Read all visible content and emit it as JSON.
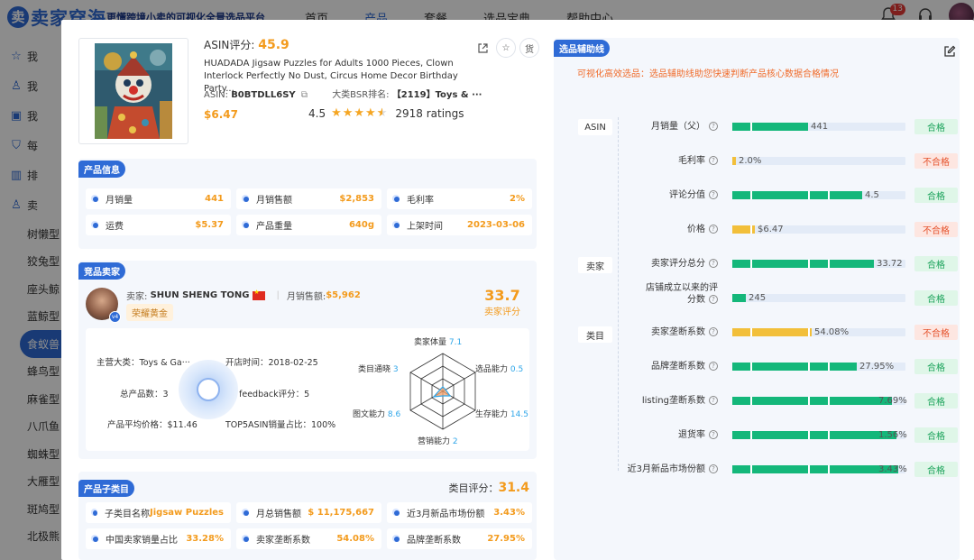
{
  "brand": {
    "name": "卖家穿海",
    "logo_char": "卖",
    "slogan": "更懂跨境小卖的可视化全景选品平台"
  },
  "nav": {
    "items": [
      "首页",
      "产品",
      "套餐",
      "选品宝典",
      "帮助中心"
    ],
    "active": "产品",
    "notification_count": "13"
  },
  "sidebar": {
    "items": [
      {
        "label": "我",
        "icon": "star-icon"
      },
      {
        "label": "我",
        "icon": "user-search-icon"
      },
      {
        "label": "我",
        "icon": "monitor-icon"
      },
      {
        "label": "每",
        "icon": "shield-icon"
      },
      {
        "label": "排",
        "icon": "bar-chart-icon"
      },
      {
        "label": "卖",
        "icon": "users-icon"
      }
    ],
    "sub_items": [
      "树懒型",
      "狡兔型",
      "座头鲸",
      "蓝鲸型",
      "食蚁兽",
      "蜂鸟型",
      "麻雀型",
      "八爪鱼",
      "蜘蛛型",
      "大雁型",
      "斑鸠型",
      "北极熊"
    ],
    "active_sub": "食蚁兽"
  },
  "product": {
    "asin_score_label": "ASIN评分:",
    "asin_score": "45.9",
    "title": "HUADADA Jigsaw Puzzles for Adults 1000 Pieces, Clown Interlock Perfectly No Dust, Circus Home Decor Birthday Party...",
    "asin_label": "ASIN:",
    "asin": "B0BTDLL6SY",
    "bsr_label": "大类BSR排名:",
    "bsr": "【2119】Toys & ···",
    "price": "$6.47",
    "rating": "4.5",
    "rating_count": "2918 ratings",
    "actions": {
      "share": "share-icon",
      "favorite": "star-icon",
      "source": "货"
    }
  },
  "product_info": {
    "tag": "产品信息",
    "cells": [
      {
        "label": "月销量",
        "value": "441"
      },
      {
        "label": "月销售额",
        "value": "$2,853"
      },
      {
        "label": "毛利率",
        "value": "2%"
      },
      {
        "label": "运费",
        "value": "$5.37"
      },
      {
        "label": "产品重量",
        "value": "640g"
      },
      {
        "label": "上架时间",
        "value": "2023-03-06"
      }
    ]
  },
  "seller": {
    "tag": "竞品卖家",
    "seller_label": "卖家:",
    "name": "SHUN SHENG TONG",
    "sales_label": "月销售额:",
    "sales": "$5,962",
    "badge": "荣耀黄金",
    "score": "33.7",
    "score_label": "卖家评分",
    "level": "v4",
    "details": {
      "category": "主营大类：Toys & Ga···",
      "open_time": "开店时间：2018-02-25",
      "total_products": "总产品数：3",
      "feedback": "feedback评分：5",
      "avg_price": "产品平均价格：$11.46",
      "top5": "TOP5ASIN销量占比：100%"
    },
    "radar": [
      {
        "label": "卖家体量",
        "value": "7.1"
      },
      {
        "label": "选品能力",
        "value": "0.5"
      },
      {
        "label": "生存能力",
        "value": "14.5"
      },
      {
        "label": "营销能力",
        "value": "2"
      },
      {
        "label": "图文能力",
        "value": "8.6"
      },
      {
        "label": "类目通晓",
        "value": "3"
      }
    ]
  },
  "subcategory": {
    "tag": "产品子类目",
    "score_label": "类目评分：",
    "score": "31.4",
    "cells": [
      {
        "label": "子类目名称",
        "value": "Jigsaw Puzzles"
      },
      {
        "label": "月总销售额",
        "value": "$ 11,175,667"
      },
      {
        "label": "近3月新品市场份额",
        "value": "3.43%"
      },
      {
        "label": "中国卖家销量占比",
        "value": "33.28%"
      },
      {
        "label": "卖家垄断系数",
        "value": "54.08%"
      },
      {
        "label": "品牌垄断系数",
        "value": "27.95%"
      }
    ]
  },
  "guide": {
    "tag": "选品辅助线",
    "desc": "可视化高效选品：选品辅助线助您快速判断产品核心数据合格情况",
    "groups": [
      "ASIN",
      "卖家",
      "类目"
    ],
    "colors": {
      "pass": "#14b77a",
      "fail": "#f2bf3a"
    },
    "metrics": [
      {
        "name": "月销量（父）",
        "value": "441",
        "fill": 0.44,
        "status": "合格",
        "pass": true
      },
      {
        "name": "毛利率",
        "value": "2.0%",
        "fill": 0.02,
        "status": "不合格",
        "pass": false
      },
      {
        "name": "评论分值",
        "value": "4.5",
        "fill": 0.75,
        "status": "合格",
        "pass": true
      },
      {
        "name": "价格",
        "value": "$6.47",
        "fill": 0.13,
        "status": "不合格",
        "pass": false
      },
      {
        "name": "卖家评分总分",
        "value": "33.72",
        "fill": 0.82,
        "status": "合格",
        "pass": true
      },
      {
        "name": "店铺成立以来的评分数",
        "value": "245",
        "fill": 0.08,
        "status": "合格",
        "pass": true
      },
      {
        "name": "卖家垄断系数",
        "value": "54.08%",
        "fill": 0.46,
        "status": "不合格",
        "pass": false
      },
      {
        "name": "品牌垄断系数",
        "value": "27.95%",
        "fill": 0.72,
        "status": "合格",
        "pass": true
      },
      {
        "name": "listing垄断系数",
        "value": "7.69%",
        "fill": 0.92,
        "status": "合格",
        "pass": true
      },
      {
        "name": "退货率",
        "value": "1.56%",
        "fill": 0.95,
        "status": "合格",
        "pass": true
      },
      {
        "name": "近3月新品市场份额",
        "value": "3.43%",
        "fill": 0.96,
        "status": "合格",
        "pass": true
      }
    ]
  }
}
